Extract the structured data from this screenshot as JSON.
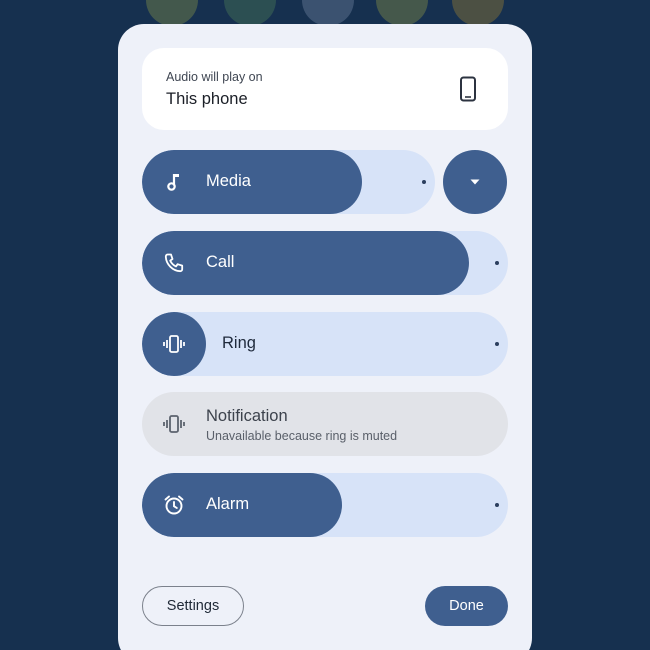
{
  "output": {
    "label": "Audio will play on",
    "device": "This phone"
  },
  "sliders": {
    "media": {
      "label": "Media",
      "level": 0.68
    },
    "call": {
      "label": "Call",
      "level": 0.87
    },
    "ring": {
      "label": "Ring",
      "level": 0.0
    },
    "alarm": {
      "label": "Alarm",
      "level": 0.45
    }
  },
  "notification": {
    "label": "Notification",
    "status": "Unavailable because ring is muted"
  },
  "buttons": {
    "settings": "Settings",
    "done": "Done"
  },
  "icons": {
    "output_device": "phone-icon",
    "media": "music-note-icon",
    "call": "phone-call-icon",
    "ring": "vibrate-icon",
    "notification": "vibrate-icon",
    "alarm": "alarm-clock-icon",
    "expand": "caret-down-icon"
  },
  "colors": {
    "accent": "#3f5f8f",
    "track": "#d7e3f8",
    "panel": "#eef1f9",
    "background": "#16304f"
  }
}
